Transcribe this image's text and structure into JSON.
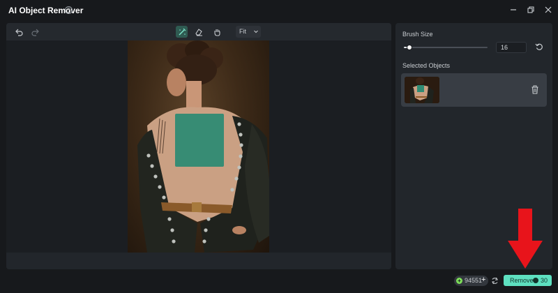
{
  "window": {
    "title": "AI Object Remover"
  },
  "toolbar": {
    "zoom_select": "Fit"
  },
  "side_panel": {
    "brush_size_label": "Brush Size",
    "brush_size_value": "16",
    "brush_size_fraction": 0.07,
    "selected_objects_label": "Selected Objects"
  },
  "footer": {
    "credits": "94551",
    "credits_plus": "+",
    "remove_label": "Remove",
    "remove_cost": "30"
  },
  "colors": {
    "accent": "#5ee0c0",
    "mask": "#2e8b73",
    "annotation_arrow": "#e8141b",
    "credit_coin": "#7ee05a"
  }
}
